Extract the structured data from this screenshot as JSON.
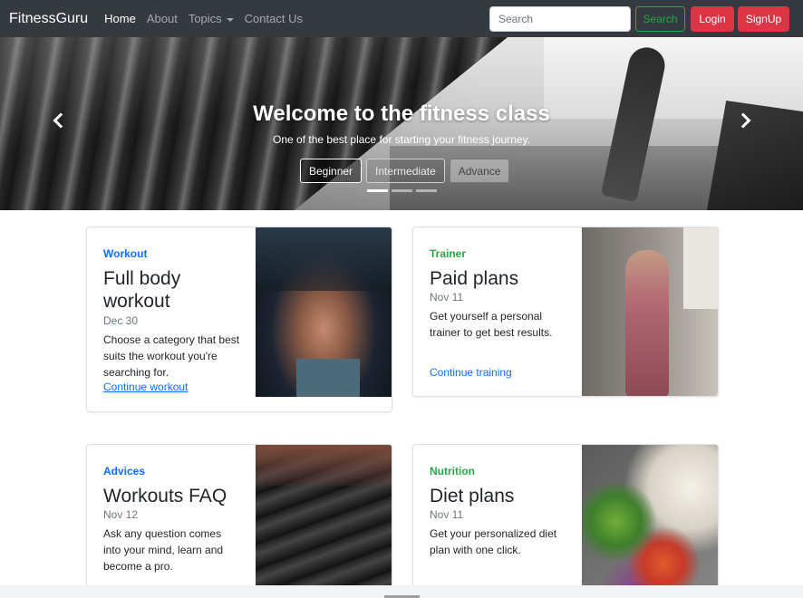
{
  "nav": {
    "brand": "FitnessGuru",
    "links": [
      "Home",
      "About",
      "Topics",
      "Contact Us"
    ],
    "search_placeholder": "Search",
    "search_button": "Search",
    "login_button": "Login",
    "signup_button": "SignUp"
  },
  "hero": {
    "title": "Welcome to the fitness class",
    "subtitle": "One of the best place for starting your fitness journey.",
    "buttons": [
      "Beginner",
      "Intermediate",
      "Advance"
    ],
    "active_slide": 1,
    "slide_count": 3
  },
  "cards": [
    {
      "category": "Workout",
      "category_color": "#0d6efd",
      "title": "Full body workout",
      "date": "Dec 30",
      "text": "Choose a category that best suits the workout you're searching for.",
      "link": "Continue workout",
      "image_icon": "abs-workout-photo"
    },
    {
      "category": "Trainer",
      "category_color": "#28a745",
      "title": "Paid plans",
      "date": "Nov 11",
      "text": "Get yourself a personal trainer to get best results.",
      "link": "Continue training",
      "image_icon": "trainer-photo"
    },
    {
      "category": "Advices",
      "category_color": "#0d6efd",
      "title": "Workouts FAQ",
      "date": "Nov 12",
      "text": "Ask any question comes into your mind, learn and become a pro.",
      "link": "",
      "image_icon": "dumbbells-photo"
    },
    {
      "category": "Nutrition",
      "category_color": "#28a745",
      "title": "Diet plans",
      "date": "Nov 11",
      "text": "Get your personalized diet plan with one click.",
      "link": "",
      "image_icon": "salad-photo"
    }
  ],
  "colors": {
    "navbar": "#343a40",
    "primary": "#0d6efd",
    "success": "#28a745",
    "danger": "#dc3545"
  }
}
